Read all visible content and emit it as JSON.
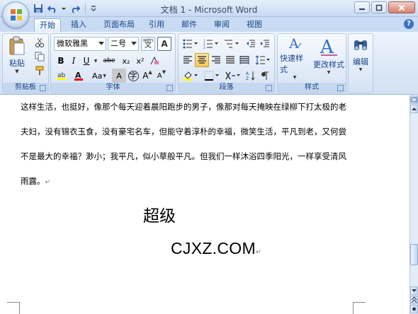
{
  "window": {
    "title": "文档 1 - Microsoft Word"
  },
  "tabs": [
    {
      "label": "开始",
      "active": true
    },
    {
      "label": "插入",
      "active": false
    },
    {
      "label": "页面布局",
      "active": false
    },
    {
      "label": "引用",
      "active": false
    },
    {
      "label": "邮件",
      "active": false
    },
    {
      "label": "审阅",
      "active": false
    },
    {
      "label": "视图",
      "active": false
    }
  ],
  "ribbon": {
    "clipboard": {
      "paste_label": "粘贴",
      "group_label": "剪贴板"
    },
    "font": {
      "font_name": "微软雅黑",
      "font_size": "二号",
      "group_label": "字体",
      "grow_font_label": "A",
      "shrink_font_label": "A",
      "wen_label": "wén",
      "bold": "B",
      "italic": "I",
      "underline": "U",
      "strike": "abe",
      "subscript": "x₂",
      "superscript": "x²",
      "change_case": "Aa",
      "char_shading": "A",
      "enclose": "字"
    },
    "paragraph": {
      "group_label": "段落"
    },
    "styles": {
      "quick_styles_label": "快速样式",
      "change_styles_label": "更改样式",
      "group_label": "样式"
    },
    "editing": {
      "label": "编辑"
    }
  },
  "document": {
    "lines": [
      "这样生活，也挺好，像那个每天迎着晨阳跑步的男子，像那对每天掩映在绿柳下打太极的老",
      "夫妇，没有锦衣玉食，没有豪宅名车，但能守着淳朴的幸福，微笑生活，平凡到老，又何尝",
      "不是最大的幸福？渺小；我平凡，似小草般平凡。但我们一样沐浴四季阳光，一样享受清风",
      "雨露。"
    ],
    "overlay_line1": "超级",
    "overlay_line2": "CJXZ.COM"
  },
  "colors": {
    "ribbon_bg": "#dbe7f6",
    "tab_text": "#15428b",
    "pressed": "#f7c95a"
  }
}
